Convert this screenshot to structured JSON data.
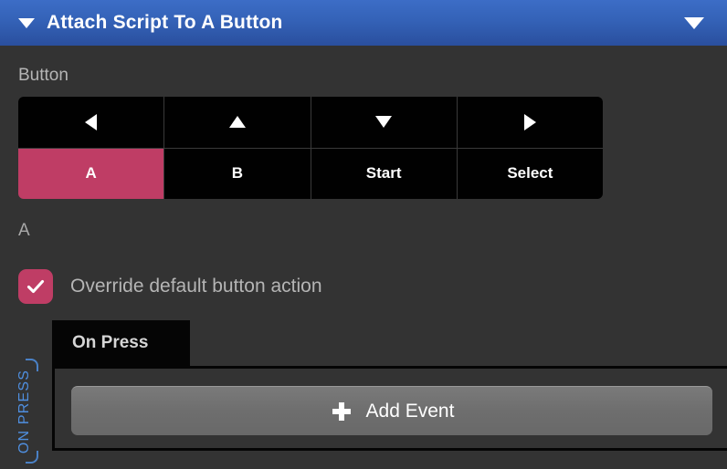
{
  "header": {
    "collapse_icon": "triangle-down-icon",
    "title": "Attach Script To A Button",
    "menu_icon": "triangle-down-icon"
  },
  "button_section": {
    "label": "Button",
    "selected": "A",
    "selected_color": "#bf3d65",
    "grid": [
      {
        "id": "dpad-left",
        "label": "",
        "icon": "triangle-left-icon",
        "selected": false
      },
      {
        "id": "dpad-up",
        "label": "",
        "icon": "triangle-up-icon",
        "selected": false
      },
      {
        "id": "dpad-down",
        "label": "",
        "icon": "triangle-down-icon",
        "selected": false
      },
      {
        "id": "dpad-right",
        "label": "",
        "icon": "triangle-right-icon",
        "selected": false
      },
      {
        "id": "btn-a",
        "label": "A",
        "icon": "",
        "selected": true
      },
      {
        "id": "btn-b",
        "label": "B",
        "icon": "",
        "selected": false
      },
      {
        "id": "btn-start",
        "label": "Start",
        "icon": "",
        "selected": false
      },
      {
        "id": "btn-select",
        "label": "Select",
        "icon": "",
        "selected": false
      }
    ]
  },
  "selected_button_name": "A",
  "override": {
    "label": "Override default button action",
    "checked": true,
    "check_icon": "checkmark-icon",
    "accent_color": "#bf3d65"
  },
  "events": {
    "tab_label": "On Press",
    "side_label": "ON PRESS",
    "side_label_color": "#4f8fe0",
    "add_event_label": "Add Event",
    "add_event_icon": "plus-icon"
  }
}
